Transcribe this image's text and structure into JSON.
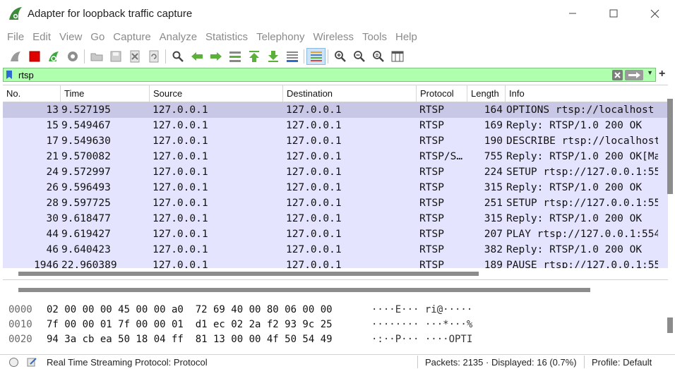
{
  "window": {
    "title": "Adapter for loopback traffic capture",
    "icon": "wireshark-shark-fin-icon",
    "controls": [
      "minimize-icon",
      "maximize-icon",
      "close-icon"
    ]
  },
  "menu": [
    "File",
    "Edit",
    "View",
    "Go",
    "Capture",
    "Analyze",
    "Statistics",
    "Telephony",
    "Wireless",
    "Tools",
    "Help"
  ],
  "toolbar_icons": [
    "start-capture-icon",
    "stop-capture-icon",
    "restart-capture-icon",
    "capture-options-icon",
    "open-file-icon",
    "save-file-icon",
    "close-file-icon",
    "reload-file-icon",
    "find-packet-icon",
    "go-back-icon",
    "go-forward-icon",
    "go-to-packet-icon",
    "first-packet-icon",
    "last-packet-icon",
    "autoscroll-icon",
    "colorize-icon",
    "zoom-in-icon",
    "zoom-out-icon",
    "normal-size-icon",
    "resize-columns-icon"
  ],
  "filter": {
    "value": "rtsp",
    "background": "#afffaf"
  },
  "columns": {
    "no": "No.",
    "time": "Time",
    "source": "Source",
    "destination": "Destination",
    "protocol": "Protocol",
    "length": "Length",
    "info": "Info"
  },
  "packets": [
    {
      "no": "13",
      "time": "9.527195",
      "source": "127.0.0.1",
      "destination": "127.0.0.1",
      "protocol": "RTSP",
      "length": "164",
      "info": "OPTIONS rtsp://localhost"
    },
    {
      "no": "15",
      "time": "9.549467",
      "source": "127.0.0.1",
      "destination": "127.0.0.1",
      "protocol": "RTSP",
      "length": "169",
      "info": "Reply: RTSP/1.0 200 OK"
    },
    {
      "no": "17",
      "time": "9.549630",
      "source": "127.0.0.1",
      "destination": "127.0.0.1",
      "protocol": "RTSP",
      "length": "190",
      "info": "DESCRIBE rtsp://localhost"
    },
    {
      "no": "21",
      "time": "9.570082",
      "source": "127.0.0.1",
      "destination": "127.0.0.1",
      "protocol": "RTSP/S…",
      "length": "755",
      "info": "Reply: RTSP/1.0 200 OK[Ma"
    },
    {
      "no": "24",
      "time": "9.572997",
      "source": "127.0.0.1",
      "destination": "127.0.0.1",
      "protocol": "RTSP",
      "length": "224",
      "info": "SETUP rtsp://127.0.0.1:55"
    },
    {
      "no": "26",
      "time": "9.596493",
      "source": "127.0.0.1",
      "destination": "127.0.0.1",
      "protocol": "RTSP",
      "length": "315",
      "info": "Reply: RTSP/1.0 200 OK"
    },
    {
      "no": "28",
      "time": "9.597725",
      "source": "127.0.0.1",
      "destination": "127.0.0.1",
      "protocol": "RTSP",
      "length": "251",
      "info": "SETUP rtsp://127.0.0.1:55"
    },
    {
      "no": "30",
      "time": "9.618477",
      "source": "127.0.0.1",
      "destination": "127.0.0.1",
      "protocol": "RTSP",
      "length": "315",
      "info": "Reply: RTSP/1.0 200 OK"
    },
    {
      "no": "44",
      "time": "9.619427",
      "source": "127.0.0.1",
      "destination": "127.0.0.1",
      "protocol": "RTSP",
      "length": "207",
      "info": "PLAY rtsp://127.0.0.1:554"
    },
    {
      "no": "46",
      "time": "9.640423",
      "source": "127.0.0.1",
      "destination": "127.0.0.1",
      "protocol": "RTSP",
      "length": "382",
      "info": "Reply: RTSP/1.0 200 OK"
    },
    {
      "no": "1946",
      "time": "22.960389",
      "source": "127.0.0.1",
      "destination": "127.0.0.1",
      "protocol": "RTSP",
      "length": "189",
      "info": "PAUSE rtsp://127.0.0.1:55"
    }
  ],
  "selected_packet": "13",
  "row_color": "#e4e4ff",
  "selected_row_color": "#c8c8e6",
  "bytes": [
    {
      "offset": "0000",
      "hex": "02 00 00 00 45 00 00 a0  72 69 40 00 80 06 00 00",
      "ascii": "····E··· ri@·····"
    },
    {
      "offset": "0010",
      "hex": "7f 00 00 01 7f 00 00 01  d1 ec 02 2a f2 93 9c 25",
      "ascii": "········ ···*···%"
    },
    {
      "offset": "0020",
      "hex": "94 3a cb ea 50 18 04 ff  81 13 00 00 4f 50 54 49",
      "ascii": "·:··P··· ····OPTI"
    }
  ],
  "status": {
    "field": "Real Time Streaming Protocol: Protocol",
    "packets": "Packets: 2135 · Displayed: 16 (0.7%)",
    "profile": "Profile: Default"
  }
}
